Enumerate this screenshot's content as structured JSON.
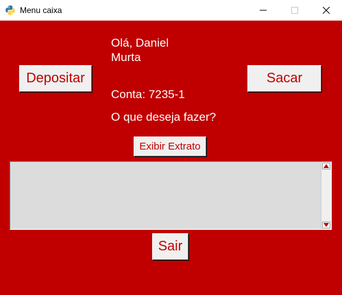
{
  "window": {
    "title": "Menu caixa",
    "icon": "python-icon"
  },
  "greeting": {
    "text": "Olá, Daniel Murta"
  },
  "account": {
    "text": "Conta: 7235-1"
  },
  "prompt": {
    "text": "O que deseja fazer?"
  },
  "buttons": {
    "deposit_label": "Depositar",
    "withdraw_label": "Sacar",
    "statement_label": "Exibir Extrato",
    "exit_label": "Sair"
  },
  "statement_area": {
    "value": ""
  },
  "colors": {
    "background": "#c00000",
    "button_text": "#c00000",
    "label_text": "#ffffff",
    "button_face": "#f0f0f0",
    "textarea_bg": "#dcdcdc"
  }
}
